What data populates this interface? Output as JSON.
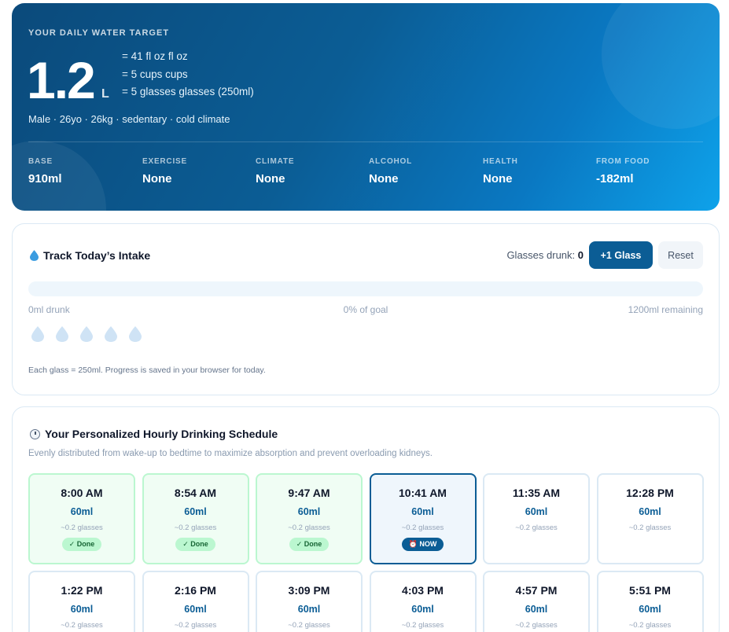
{
  "hero": {
    "label": "YOUR DAILY WATER TARGET",
    "amount": "1.2",
    "unit": "L",
    "equivalents": [
      "= 41 fl oz fl oz",
      "= 5 cups cups",
      "= 5 glasses glasses (250ml)"
    ],
    "profile": "Male · 26yo · 26kg · sedentary · cold climate",
    "stats": [
      {
        "key": "BASE",
        "value": "910ml"
      },
      {
        "key": "EXERCISE",
        "value": "None"
      },
      {
        "key": "CLIMATE",
        "value": "None"
      },
      {
        "key": "ALCOHOL",
        "value": "None"
      },
      {
        "key": "HEALTH",
        "value": "None"
      },
      {
        "key": "FROM FOOD",
        "value": "-182ml"
      }
    ]
  },
  "tracker": {
    "title": "Track Today’s Intake",
    "glasses_label": "Glasses drunk:",
    "glasses_count": "0",
    "add_button": "+1 Glass",
    "reset_button": "Reset",
    "progress": 0,
    "drunk_text": "0ml drunk",
    "goal_text": "0% of goal",
    "remaining_text": "1200ml remaining",
    "glass_icons": 5,
    "note": "Each glass = 250ml. Progress is saved in your browser for today."
  },
  "schedule": {
    "title": "Your Personalized Hourly Drinking Schedule",
    "subtitle": "Evenly distributed from wake-up to bedtime to maximize absorption and prevent overloading kidneys.",
    "slots": [
      {
        "time": "8:00 AM",
        "amount": "60ml",
        "glasses": "~0.2 glasses",
        "status": "done",
        "badge": "✓ Done"
      },
      {
        "time": "8:54 AM",
        "amount": "60ml",
        "glasses": "~0.2 glasses",
        "status": "done",
        "badge": "✓ Done"
      },
      {
        "time": "9:47 AM",
        "amount": "60ml",
        "glasses": "~0.2 glasses",
        "status": "done",
        "badge": "✓ Done"
      },
      {
        "time": "10:41 AM",
        "amount": "60ml",
        "glasses": "~0.2 glasses",
        "status": "now",
        "badge": "⏰ NOW"
      },
      {
        "time": "11:35 AM",
        "amount": "60ml",
        "glasses": "~0.2 glasses",
        "status": "upcoming",
        "badge": ""
      },
      {
        "time": "12:28 PM",
        "amount": "60ml",
        "glasses": "~0.2 glasses",
        "status": "upcoming",
        "badge": ""
      },
      {
        "time": "1:22 PM",
        "amount": "60ml",
        "glasses": "~0.2 glasses",
        "status": "upcoming",
        "badge": ""
      },
      {
        "time": "2:16 PM",
        "amount": "60ml",
        "glasses": "~0.2 glasses",
        "status": "upcoming",
        "badge": ""
      },
      {
        "time": "3:09 PM",
        "amount": "60ml",
        "glasses": "~0.2 glasses",
        "status": "upcoming",
        "badge": ""
      },
      {
        "time": "4:03 PM",
        "amount": "60ml",
        "glasses": "~0.2 glasses",
        "status": "upcoming",
        "badge": ""
      },
      {
        "time": "4:57 PM",
        "amount": "60ml",
        "glasses": "~0.2 glasses",
        "status": "upcoming",
        "badge": ""
      },
      {
        "time": "5:51 PM",
        "amount": "60ml",
        "glasses": "~0.2 glasses",
        "status": "upcoming",
        "badge": ""
      }
    ]
  },
  "colors": {
    "accent": "#0b5d95",
    "done_bg": "#f0fdf4",
    "done_border": "#bbf7d0",
    "now_border": "#0b5d95"
  }
}
